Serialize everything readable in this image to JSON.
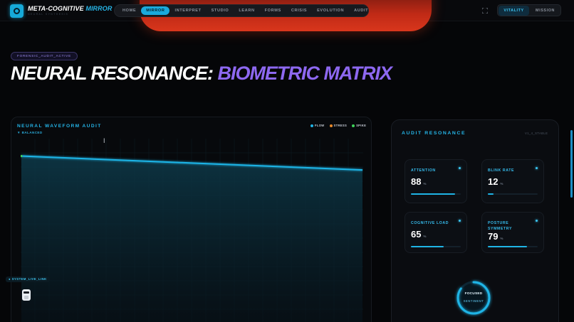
{
  "header": {
    "brand_part1": "META-COGNITIVE",
    "brand_part2": "MIRROR",
    "brand_subtitle": "NEURAL SYNTHESIS",
    "nav": [
      {
        "label": "HOME",
        "active": false
      },
      {
        "label": "MIRROR",
        "active": true
      },
      {
        "label": "INTERPRET",
        "active": false
      },
      {
        "label": "STUDIO",
        "active": false
      },
      {
        "label": "LEARN",
        "active": false
      },
      {
        "label": "FORMS",
        "active": false
      },
      {
        "label": "CRISIS",
        "active": false
      },
      {
        "label": "EVOLUTION",
        "active": false
      },
      {
        "label": "AUDIT",
        "active": false
      }
    ],
    "right_tabs": [
      {
        "label": "VITALITY",
        "active": true
      },
      {
        "label": "MISSION",
        "active": false
      }
    ]
  },
  "hero": {
    "status_pill": "FORENSIC_AUDIT_ACTIVE",
    "title_part1": "NEURAL RESONANCE:",
    "title_part2": "BIOMETRIC MATRIX"
  },
  "waveform": {
    "title": "NEURAL WAVEFORM AUDIT",
    "state": "▼ BALANCED",
    "legend": [
      {
        "label": "FLOW",
        "color": "#1fb4e6"
      },
      {
        "label": "STRESS",
        "color": "#e8892a"
      },
      {
        "label": "SPIKE",
        "color": "#3fd25a"
      }
    ],
    "live_link": "● SYSTEM_LIVE_LINK"
  },
  "chart_data": {
    "type": "area",
    "series": [
      {
        "values": [
          100,
          98,
          96,
          94,
          92
        ]
      }
    ],
    "ylim": [
      0,
      110
    ],
    "grid": true
  },
  "audit": {
    "title": "AUDIT RESONANCE",
    "version": "V1_4_STABLE",
    "metrics": [
      {
        "label": "ATTENTION",
        "value": "88",
        "unit": "%",
        "level": 0.88
      },
      {
        "label": "BLINK RATE",
        "value": "12",
        "unit": "%",
        "level": 0.12
      },
      {
        "label": "COGNITIVE LOAD",
        "value": "65",
        "unit": "%",
        "level": 0.65
      },
      {
        "label": "POSTURE SYMMETRY",
        "value": "79",
        "unit": "%",
        "level": 0.79
      }
    ],
    "gauge": {
      "label": "FOCUSED",
      "sublabel": "SENTIMENT",
      "level": 0.85
    }
  },
  "colors": {
    "accent": "#1fb4e6",
    "violet": "#8d68f0",
    "glow": "#d8361c"
  }
}
